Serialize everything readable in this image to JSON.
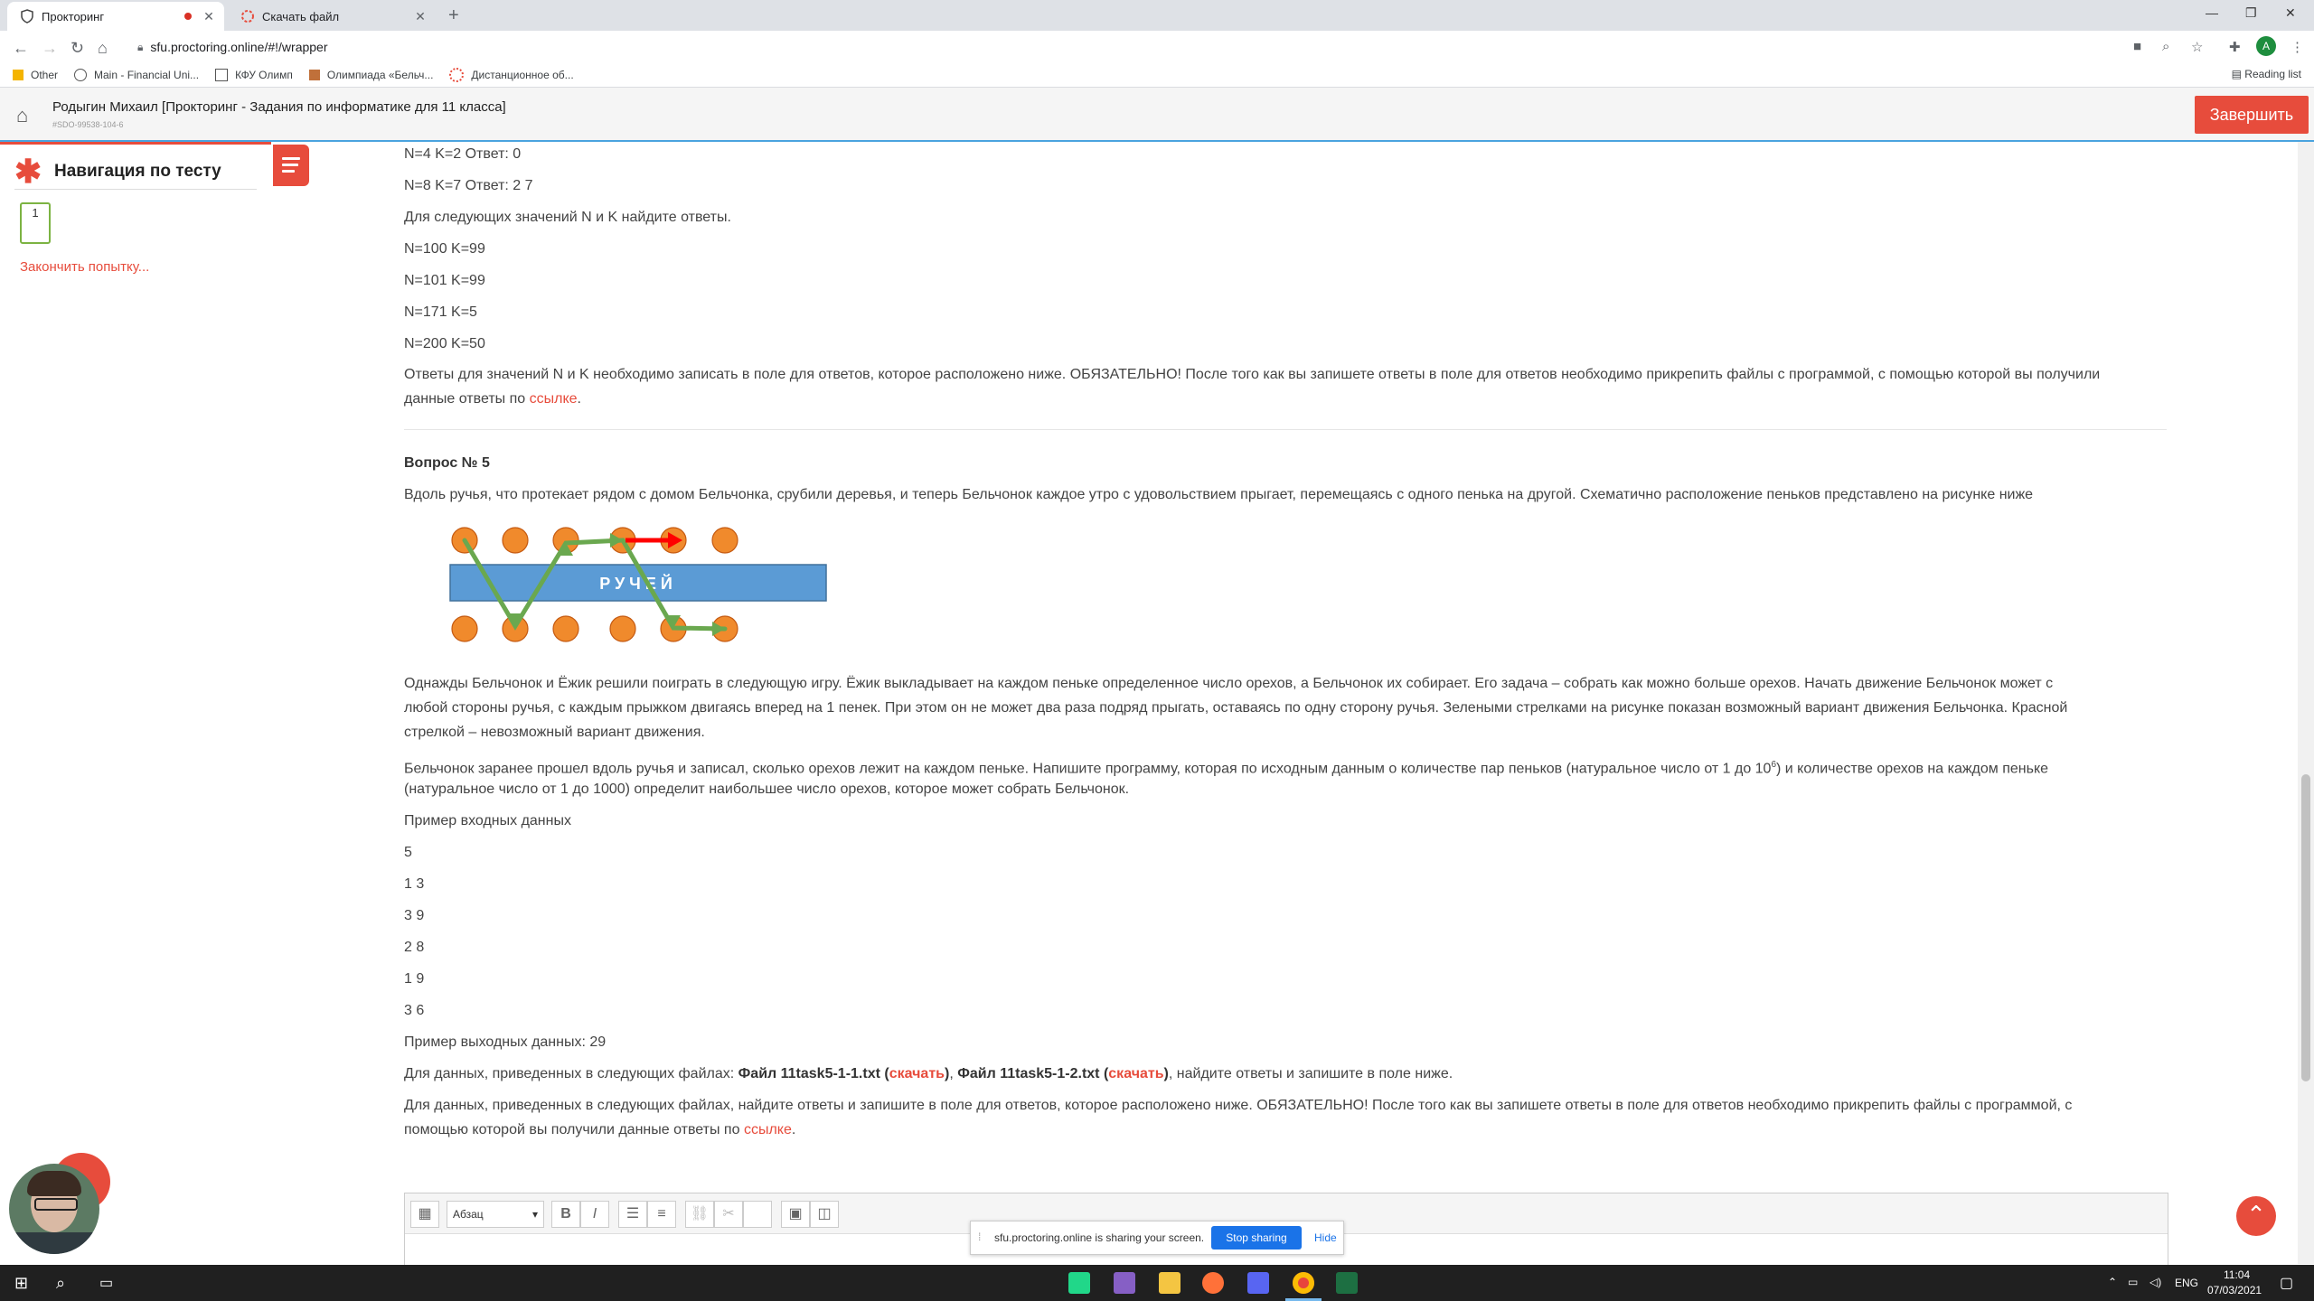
{
  "browser": {
    "tabs": [
      {
        "title": "Прокторинг",
        "active": true
      },
      {
        "title": "Скачать файл",
        "active": false
      }
    ],
    "url": "sfu.proctoring.online/#!/wrapper",
    "bookmarks": [
      "Other",
      "Main - Financial Uni...",
      "КФУ Олимп",
      "Олимпиада «Бельч...",
      "Дистанционное об..."
    ],
    "reading_list": "Reading list"
  },
  "header": {
    "title": "Родыгин Михаил [Прокторинг - Задания по информатике для 11 класса]",
    "subtitle": "#SDO-99538-104-6",
    "finish_button": "Завершить"
  },
  "sidebar": {
    "title": "Навигация по тесту",
    "question_number": "1",
    "finish_attempt_link": "Закончить попытку..."
  },
  "question4_tail": {
    "line1": "N=4 K=2 Ответ: 0",
    "line2": "N=8 K=7 Ответ: 2 7",
    "line3": "Для следующих значений N и K найдите ответы.",
    "line4": "N=100 K=99",
    "line5": "N=101 K=99",
    "line6": "N=171 K=5",
    "line7": "N=200 K=50",
    "answers_note": "Ответы для значений N и K необходимо записать в поле для ответов, которое расположено ниже. ОБЯЗАТЕЛЬНО! После того как вы запишете ответы в поле для ответов необходимо прикрепить файлы с программой, с помощью которой вы получили",
    "answers_note2": "данные ответы по",
    "link": "ссылке"
  },
  "question5": {
    "title": "Вопрос № 5",
    "intro": "Вдоль ручья, что протекает рядом с домом Бельчонка, срубили деревья, и теперь Бельчонок каждое утро с удовольствием прыгает, перемещаясь с одного пенька на другой. Схематично расположение пеньков представлено на рисунке ниже",
    "stream_label": "РУЧЕЙ",
    "p1_l1": "Однажды Бельчонок и Ёжик решили поиграть в следующую игру. Ёжик выкладывает на каждом пеньке определенное число орехов, а Бельчонок их собирает. Его задача – собрать как можно больше орехов. Начать движение Бельчонок может с",
    "p1_l2": "любой стороны ручья, с каждым прыжком двигаясь вперед на 1 пенек. При этом он не может два раза подряд прыгать, оставаясь по одну сторону ручья. Зелеными стрелками на рисунке показан возможный вариант движения Бельчонка. Красной",
    "p1_l3": "стрелкой – невозможный вариант движения.",
    "p2_l1a": "Бельчонок заранее прошел вдоль ручья и записал, сколько орехов лежит на каждом пеньке. Напишите программу, которая по исходным данным о количестве пар пеньков (натуральное число от 1 до 10",
    "p2_sup": "6",
    "p2_l1b": ") и количестве орехов на каждом пеньке",
    "p2_l2": "(натуральное число от 1 до 1000) определит наибольшее число орехов, которое может собрать Бельчонок.",
    "example_in_label": "Пример входных данных",
    "example_in": [
      "5",
      "1 3",
      "3 9",
      "2 8",
      "1 9",
      "3 6"
    ],
    "example_out": "Пример выходных данных: 29",
    "files_pre": "Для данных, приведенных в следующих файлах: ",
    "file1": "Файл 11task5-1-1.txt",
    "file2": "Файл 11task5-1-2.txt",
    "download": "скачать",
    "files_post": ", найдите ответы и запишите в поле ниже.",
    "final_l1": "Для данных, приведенных в следующих файлах, найдите ответы и запишите в поле для ответов, которое расположено ниже. ОБЯЗАТЕЛЬНО! После того как вы запишете ответы в поле для ответов необходимо прикрепить файлы с программой, с",
    "final_l2": "помощью которой вы получили данные ответы по",
    "link": "ссылке"
  },
  "editor": {
    "format_select": "Абзац"
  },
  "sharebar": {
    "text": "sfu.proctoring.online is sharing your screen.",
    "stop": "Stop sharing",
    "hide": "Hide"
  },
  "taskbar": {
    "lang": "ENG",
    "time": "11:04",
    "date": "07/03/2021"
  },
  "colors": {
    "accent": "#e74c3c",
    "stump": "#f08a2c",
    "stream": "#5b9bd5",
    "path_green": "#6aa84f",
    "path_red": "#ff0000"
  }
}
